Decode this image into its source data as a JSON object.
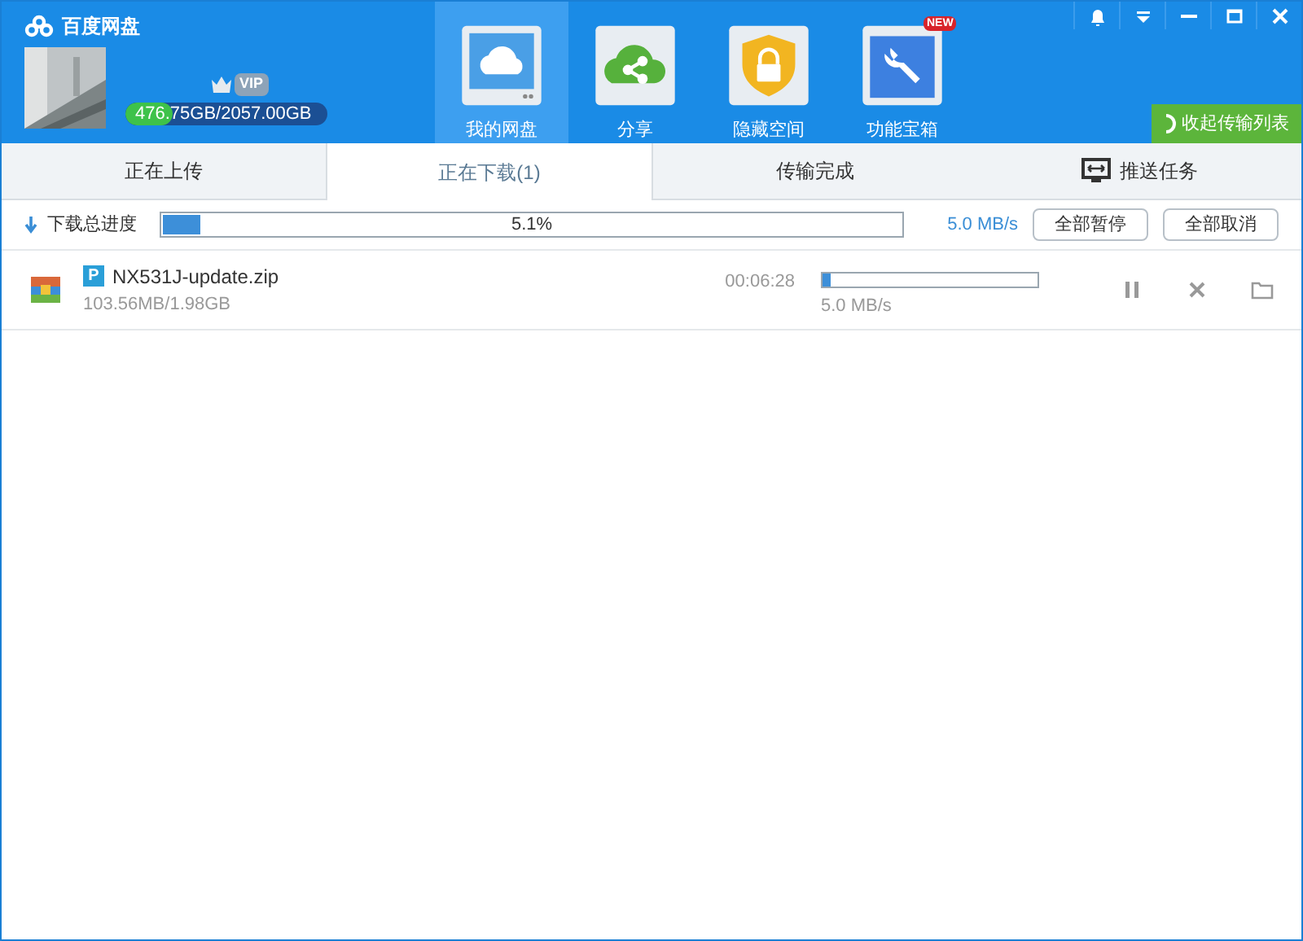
{
  "app": {
    "title": "百度网盘",
    "badge": "VIP",
    "storage": {
      "text": "476.75GB/2057.00GB",
      "level": 0.23
    }
  },
  "nav": [
    {
      "label": "我的网盘",
      "selected": true
    },
    {
      "label": "分享",
      "selected": false
    },
    {
      "label": "隐藏空间",
      "selected": false
    },
    {
      "label": "功能宝箱",
      "selected": false,
      "badge": "NEW"
    }
  ],
  "collapse_button": "收起传输列表",
  "tabs": [
    {
      "label": "正在上传",
      "selected": false
    },
    {
      "label": "正在下载(1)",
      "selected": true
    },
    {
      "label": "传输完成",
      "selected": false
    },
    {
      "label": "推送任务",
      "selected": false,
      "kind": "icon"
    }
  ],
  "total": {
    "label": "下载总进度",
    "level": 0.051,
    "percent": "5.1%",
    "speed": "5.0 MB/s",
    "buttons": [
      "全部暂停",
      "全部取消"
    ]
  },
  "downloads": [
    {
      "type_badge": "P",
      "name": "NX531J-update.zip",
      "size": "103.56MB/1.98GB",
      "time_left": "00:06:28",
      "level": 0.04,
      "speed": "5.0 MB/s"
    }
  ]
}
